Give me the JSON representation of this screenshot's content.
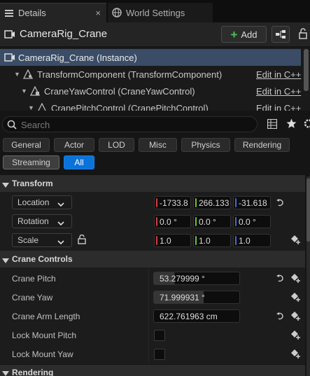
{
  "tabs": [
    {
      "label": "Details",
      "icon": "details-icon",
      "active": true,
      "close": "×"
    },
    {
      "label": "World Settings",
      "icon": "globe-icon",
      "active": false
    }
  ],
  "header": {
    "actor_name": "CameraRig_Crane",
    "add_label": "Add"
  },
  "tree": [
    {
      "label": "CameraRig_Crane (Instance)",
      "selected": true
    },
    {
      "label": "TransformComponent (TransformComponent)",
      "edit": "Edit in C++"
    },
    {
      "label": "CraneYawControl (CraneYawControl)",
      "edit": "Edit in C++"
    },
    {
      "label": "CranePitchControl (CranePitchControl)",
      "edit": "Edit in C++"
    }
  ],
  "search": {
    "placeholder": "Search"
  },
  "filters": {
    "row1": [
      "General",
      "Actor",
      "LOD",
      "Misc",
      "Physics",
      "Rendering"
    ],
    "row2": [
      "Streaming",
      "All"
    ]
  },
  "transform": {
    "title": "Transform",
    "location": {
      "label": "Location",
      "x": "-1733.8",
      "y": "266.133",
      "z": "-31.618"
    },
    "rotation": {
      "label": "Rotation",
      "x": "0.0 °",
      "y": "0.0 °",
      "z": "0.0 °"
    },
    "scale": {
      "label": "Scale",
      "x": "1.0",
      "y": "1.0",
      "z": "1.0"
    }
  },
  "crane": {
    "title": "Crane Controls",
    "pitch": {
      "label": "Crane Pitch",
      "value": "53.279999 °",
      "fill": 0.24
    },
    "yaw": {
      "label": "Crane Yaw",
      "value": "71.999931 °",
      "fill": 0.58
    },
    "arm": {
      "label": "Crane Arm Length",
      "value": "622.761963 cm"
    },
    "lock_pitch": {
      "label": "Lock Mount Pitch",
      "checked": false
    },
    "lock_yaw": {
      "label": "Lock Mount Yaw",
      "checked": false
    }
  },
  "rendering": {
    "title": "Rendering"
  },
  "colors": {
    "accent_blue": "#0b72d9",
    "selection": "#3a4c66",
    "axis_x": "#d33a3a",
    "axis_y": "#6fbf2a",
    "axis_z": "#3a6fd8",
    "add_plus": "#4fc24f"
  }
}
